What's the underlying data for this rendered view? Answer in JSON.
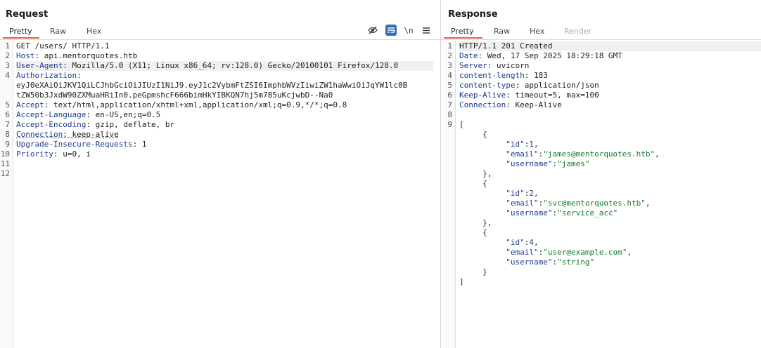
{
  "request": {
    "title": "Request",
    "tabs": [
      "Pretty",
      "Raw",
      "Hex"
    ],
    "active_tab": "Pretty",
    "toolbar": {
      "newline_label": "\\n"
    },
    "line_numbers": [
      "1",
      "2",
      "3",
      "4",
      "5",
      "6",
      "7",
      "8",
      "9",
      "10",
      "11",
      "12"
    ],
    "lines": {
      "l1": "GET /users/ HTTP/1.1",
      "l2k": "Host",
      "l2v": " api.mentorquotes.htb",
      "l3k": "User-Agent",
      "l3v": " Mozilla/5.0 (X11; Linux x86_64; rv:128.0) Gecko/20100101 Firefox/128.0",
      "l4k": "Authorization",
      "l4a": "eyJ0eXAiOiJKV1QiLCJhbGciOiJIUzI1NiJ9.eyJ1c2VybmFtZSI6ImphbWVzIiwiZW1haWwiOiJqYW1lc0B",
      "l4b": "tZW50b3JxdW90ZXMuaHRiIn0.peGpmshcF666bimHkYIBKQN7hj5m785uKcjwbD--Na0",
      "l5k": "Accept",
      "l5v": " text/html,application/xhtml+xml,application/xml;q=0.9,*/*;q=0.8",
      "l6k": "Accept-Language",
      "l6v": " en-US,en;q=0.5",
      "l7k": "Accept-Encoding",
      "l7v": " gzip, deflate, br",
      "l8k": "Connection",
      "l8v": " keep-alive",
      "l9k": "Upgrade-Insecure-Requests",
      "l9v": " 1",
      "l10k": "Priority",
      "l10v": " u=0, i"
    }
  },
  "response": {
    "title": "Response",
    "tabs": [
      "Pretty",
      "Raw",
      "Hex",
      "Render"
    ],
    "active_tab": "Pretty",
    "line_numbers": [
      "1",
      "2",
      "3",
      "4",
      "5",
      "6",
      "7",
      "8",
      "9"
    ],
    "status_line": "HTTP/1.1 201 Created",
    "headers": [
      {
        "k": "Date",
        "v": " Wed, 17 Sep 2025 18:29:18 GMT"
      },
      {
        "k": "Server",
        "v": " uvicorn"
      },
      {
        "k": "content-length",
        "v": " 183"
      },
      {
        "k": "content-type",
        "v": " application/json"
      },
      {
        "k": "Keep-Alive",
        "v": " timeout=5, max=100"
      },
      {
        "k": "Connection",
        "v": " Keep-Alive"
      }
    ],
    "users": [
      {
        "id": "1",
        "email": "james@mentorquotes.htb",
        "username": "james"
      },
      {
        "id": "2",
        "email": "svc@mentorquotes.htb",
        "username": "service_acc"
      },
      {
        "id": "4",
        "email": "user@example.com",
        "username": "string"
      }
    ]
  }
}
